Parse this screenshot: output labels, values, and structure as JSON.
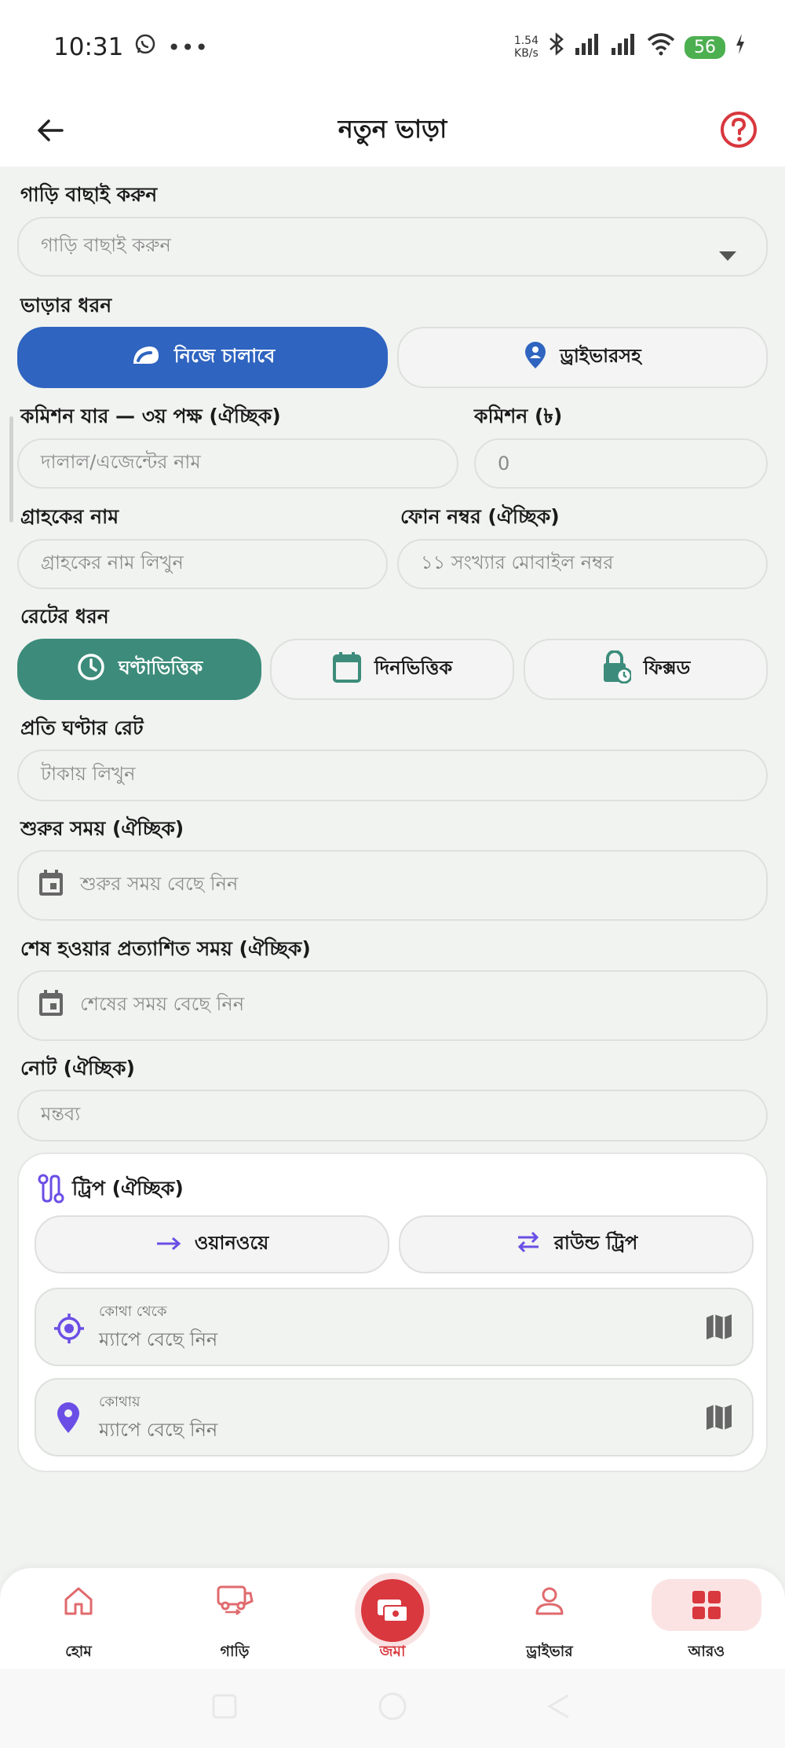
{
  "status_bar": {
    "time": "10:31",
    "speed_value": "1.54",
    "speed_unit": "KB/s",
    "battery": "56",
    "icons": [
      "whatsapp-icon",
      "more-dots-icon",
      "bluetooth-icon",
      "signal-icon",
      "signal-icon",
      "wifi-icon",
      "battery-icon",
      "charging-icon"
    ]
  },
  "app_bar": {
    "title": "নতুন ভাড়া",
    "back_icon": "back-arrow-icon",
    "help_icon": "help-icon"
  },
  "form": {
    "car_label": "গাড়ি বাছাই করুন",
    "car_select_value": "গাড়ি বাছাই করুন",
    "rent_type_label": "ভাড়ার ধরন",
    "rent_types": [
      {
        "label": "নিজে চালাবে",
        "icon": "self-drive-icon",
        "selected": true
      },
      {
        "label": "ড্রাইভারসহ",
        "icon": "driver-pin-icon",
        "selected": false
      }
    ],
    "commission_party_label": "কমিশন যার — ৩য় পক্ষ (ঐচ্ছিক)",
    "commission_party_placeholder": "দালাল/এজেন্টের নাম",
    "commission_label": "কমিশন (৳)",
    "commission_placeholder": "0",
    "customer_name_label": "গ্রাহকের নাম",
    "customer_name_placeholder": "গ্রাহকের নাম লিখুন",
    "phone_label": "ফোন নম্বর (ঐচ্ছিক)",
    "phone_placeholder": "১১ সংখ্যার মোবাইল নম্বর",
    "rate_type_label": "রেটের ধরন",
    "rate_types": [
      {
        "label": "ঘণ্টাভিত্তিক",
        "icon": "clock-icon",
        "selected": true
      },
      {
        "label": "দিনভিত্তিক",
        "icon": "calendar-icon",
        "selected": false
      },
      {
        "label": "ফিক্সড",
        "icon": "lock-clock-icon",
        "selected": false
      }
    ],
    "hourly_rate_label": "প্রতি ঘণ্টার রেট",
    "hourly_rate_placeholder": "টাকায় লিখুন",
    "start_time_label": "শুরুর সময় (ঐচ্ছিক)",
    "start_time_placeholder": "শুরুর সময় বেছে নিন",
    "end_time_label": "শেষ হওয়ার প্রত্যাশিত সময় (ঐচ্ছিক)",
    "end_time_placeholder": "শেষের সময় বেছে নিন",
    "note_label": "নোট (ঐচ্ছিক)",
    "note_placeholder": "মন্তব্য"
  },
  "trip": {
    "title": "ট্রিপ (ঐচ্ছিক)",
    "types": [
      {
        "label": "ওয়ানওয়ে",
        "icon": "arrow-right-icon"
      },
      {
        "label": "রাউন্ড ট্রিপ",
        "icon": "swap-arrows-icon"
      }
    ],
    "from_label": "কোথা থেকে",
    "from_value": "ম্যাপে বেছে নিন",
    "to_label": "কোথায়",
    "to_value": "ম্যাপে বেছে নিন"
  },
  "colors": {
    "blue": "#2f64c0",
    "green": "#3d8c7b",
    "red": "#d8383e",
    "purple": "#6b4ee6"
  },
  "bottom_nav": [
    {
      "label": "হোম",
      "icon": "home-icon"
    },
    {
      "label": "গাড়ি",
      "icon": "car-icon"
    },
    {
      "label": "জমা",
      "icon": "deposit-icon"
    },
    {
      "label": "ড্রাইভার",
      "icon": "driver-icon"
    },
    {
      "label": "আরও",
      "icon": "grid-icon"
    }
  ]
}
